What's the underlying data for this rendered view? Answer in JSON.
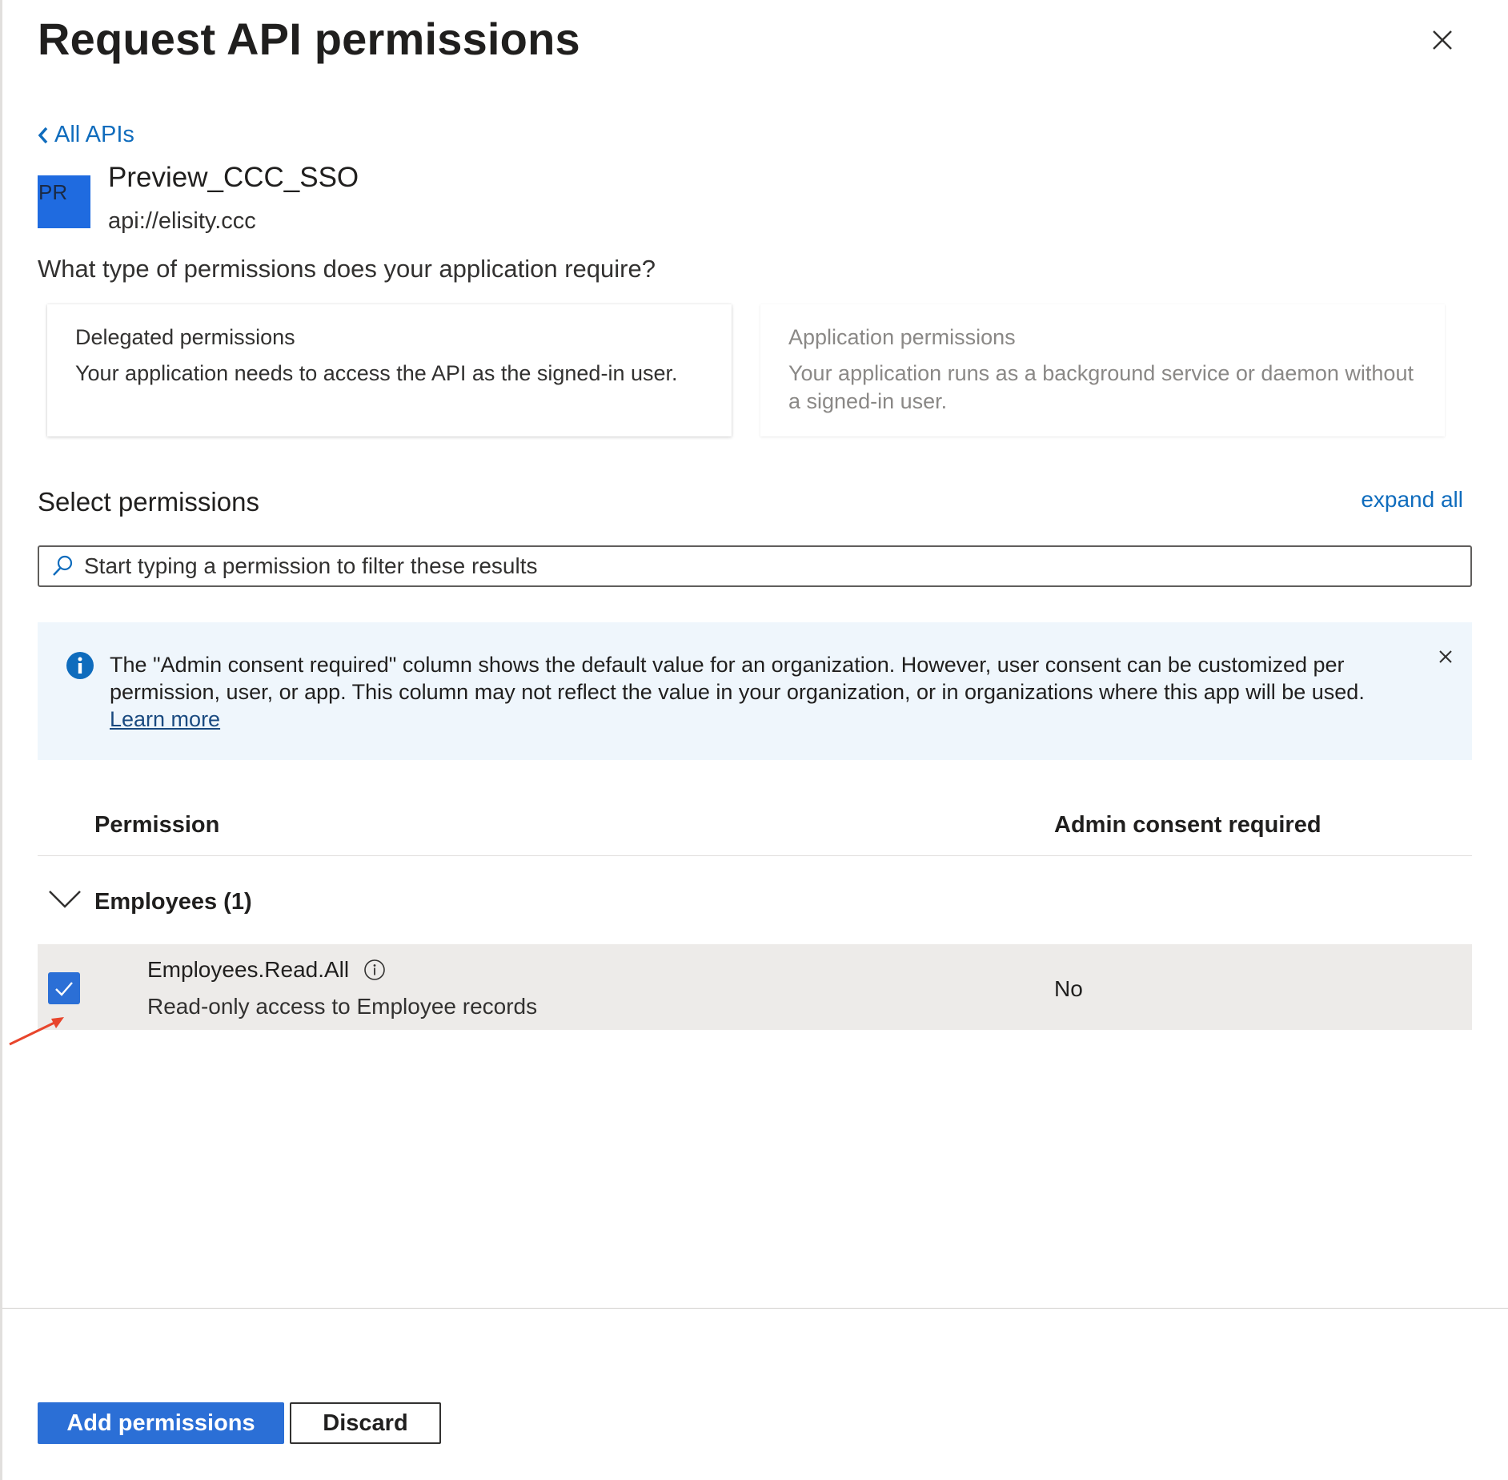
{
  "header": {
    "title": "Request API permissions"
  },
  "nav": {
    "back_label": "All APIs"
  },
  "api": {
    "badge": "PR",
    "name": "Preview_CCC_SSO",
    "uri": "api://elisity.ccc"
  },
  "permission_type": {
    "question": "What type of permissions does your application require?",
    "delegated": {
      "title": "Delegated permissions",
      "description": "Your application needs to access the API as the signed-in user."
    },
    "application": {
      "title": "Application permissions",
      "description": "Your application runs as a background service or daemon without a signed-in user."
    }
  },
  "select": {
    "title": "Select permissions",
    "expand_all": "expand all",
    "search_placeholder": "Start typing a permission to filter these results"
  },
  "info_bar": {
    "message": "The \"Admin consent required\" column shows the default value for an organization. However, user consent can be customized per permission, user, or app. This column may not reflect the value in your organization, or in organizations where this app will be used.",
    "link": "Learn more"
  },
  "table": {
    "columns": {
      "permission": "Permission",
      "admin": "Admin consent required"
    },
    "groups": [
      {
        "label": "Employees (1)",
        "expanded": true,
        "items": [
          {
            "name": "Employees.Read.All",
            "description": "Read-only access to Employee records",
            "admin_consent": "No",
            "checked": true
          }
        ]
      }
    ]
  },
  "footer": {
    "primary_label": "Add permissions",
    "secondary_label": "Discard"
  },
  "colors": {
    "accent": "#2b6fd6",
    "link": "#0f6cbd",
    "info_background": "#eff6fc",
    "selected_row": "#edebe9",
    "annotation_arrow": "#e8452c"
  },
  "icons": {
    "close": "close-icon",
    "back": "chevron-left-icon",
    "search": "search-icon",
    "info": "info-icon",
    "group_toggle": "chevron-down-icon",
    "checkbox": "checkmark-icon",
    "permission_info": "info-circle-icon"
  }
}
